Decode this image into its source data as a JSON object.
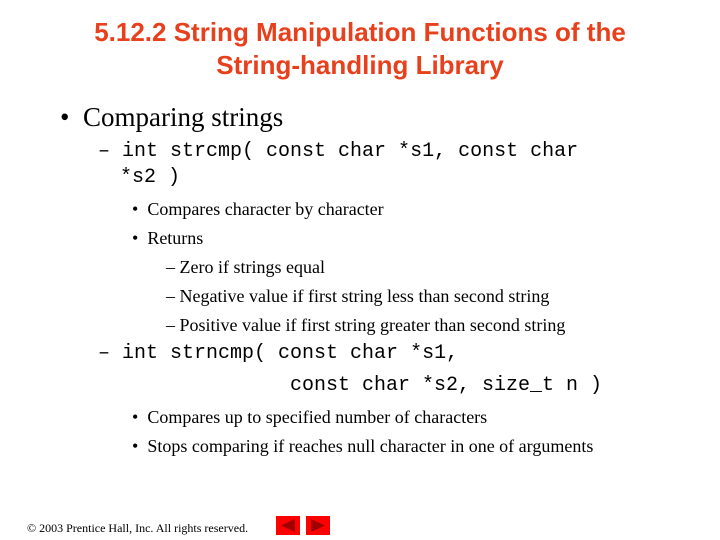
{
  "title": {
    "line1": "5.12.2 String Manipulation Functions of the",
    "line2": "String-handling Library"
  },
  "content": {
    "bullet": "Comparing strings",
    "strcmp": {
      "sig_line1": "int strcmp( const char *s1, const char",
      "sig_line2": "*s2 )",
      "items": [
        "Compares character by character",
        "Returns"
      ],
      "returns": [
        "Zero if strings equal",
        "Negative value if first string less than second string",
        "Positive value if first string greater than second string"
      ]
    },
    "strncmp": {
      "sig_line1": "int strncmp( const char *s1,",
      "sig_line2": "const char *s2, size_t n )",
      "items": [
        "Compares up to specified number of characters",
        "Stops comparing if reaches null character in one of arguments"
      ]
    }
  },
  "footer": {
    "copyright": "© 2003 Prentice Hall, Inc.  All rights reserved.",
    "prev_icon": "triangle-left-icon",
    "next_icon": "triangle-right-icon",
    "nav_color": "#ff0000"
  },
  "colors": {
    "title": "#e8401c"
  }
}
